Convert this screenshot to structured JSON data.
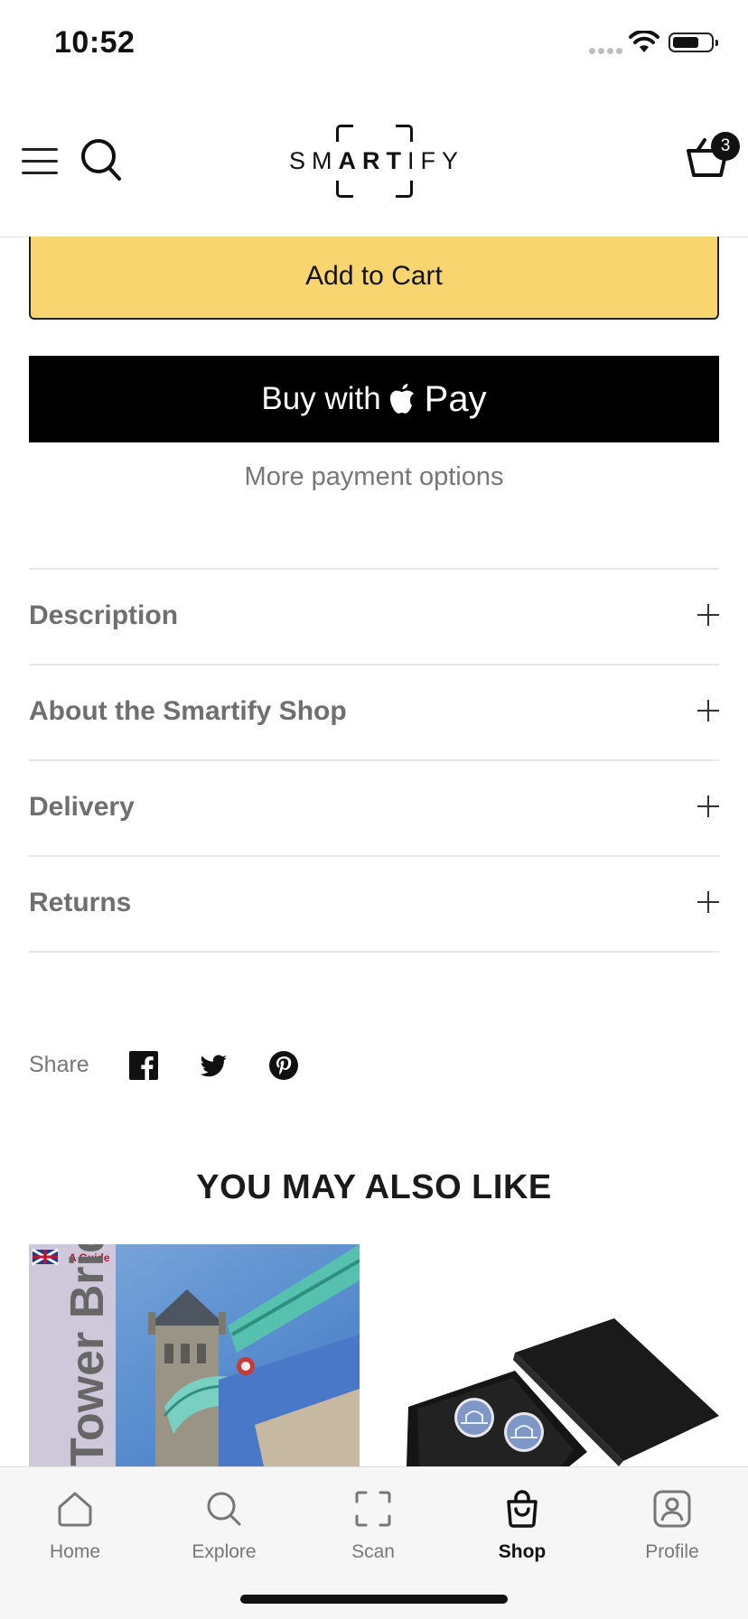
{
  "status_bar": {
    "time": "10:52"
  },
  "header": {
    "logo": {
      "prefix": "SM",
      "bold": "ART",
      "suffix": "IFY"
    },
    "cart_count": "3"
  },
  "purchase": {
    "add_to_cart": "Add to Cart",
    "apple_pay_prefix": "Buy with",
    "apple_pay_suffix": "Pay",
    "more_payment": "More payment options"
  },
  "accordion": [
    {
      "label": "Description"
    },
    {
      "label": "About the Smartify Shop"
    },
    {
      "label": "Delivery"
    },
    {
      "label": "Returns"
    }
  ],
  "share": {
    "label": "Share",
    "networks": [
      "facebook",
      "twitter",
      "pinterest"
    ]
  },
  "also_like": {
    "title": "YOU MAY ALSO LIKE",
    "products": [
      {
        "cover_tag": "A Guide",
        "cover_title": "Tower Bridge"
      },
      {
        "image": "cufflinks-box"
      }
    ]
  },
  "tabbar": {
    "tabs": [
      {
        "label": "Home",
        "icon": "home-icon"
      },
      {
        "label": "Explore",
        "icon": "search-icon"
      },
      {
        "label": "Scan",
        "icon": "scan-icon"
      },
      {
        "label": "Shop",
        "icon": "bag-icon",
        "active": true
      },
      {
        "label": "Profile",
        "icon": "profile-icon"
      }
    ]
  },
  "colors": {
    "accent_yellow": "#f9d56f",
    "text_muted": "#6f6f6f",
    "active_tab": "#111111"
  }
}
